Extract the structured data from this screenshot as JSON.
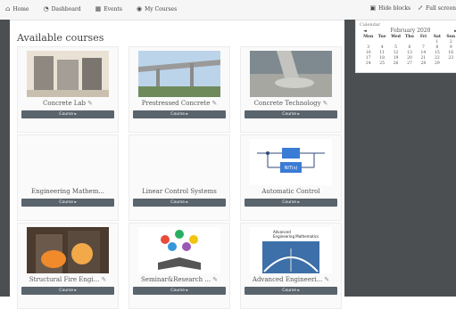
{
  "nav": {
    "home": {
      "label": "Home",
      "icon": "home-icon"
    },
    "dashboard": {
      "label": "Dashboard",
      "icon": "dashboard-icon"
    },
    "events": {
      "label": "Events",
      "icon": "calendar-icon"
    },
    "my_courses": {
      "label": "My Courses",
      "icon": "courses-icon"
    }
  },
  "topright": {
    "hide_blocks": "Hide blocks",
    "full_screen": "Full screen"
  },
  "page": {
    "title": "Available courses"
  },
  "courses": [
    {
      "name": "Concrete Lab",
      "button": "Course ▸"
    },
    {
      "name": "Prestressed Concrete",
      "button": "Course ▸"
    },
    {
      "name": "Concrete Technology",
      "button": "Course ▸"
    },
    {
      "name": "Engineering Mathem...",
      "button": "Course ▸"
    },
    {
      "name": "Linear Control Systems",
      "button": "Course ▸"
    },
    {
      "name": "Automatic Control",
      "button": "Course ▸"
    },
    {
      "name": "Structural Fire Engi...",
      "button": "Course ▸"
    },
    {
      "name": "Seminar&Research ...",
      "button": "Course ▸"
    },
    {
      "name": "Advanced Engineeri...",
      "button": "Course ▸"
    }
  ],
  "thumb_text": {
    "nit_label": "NIT(s)",
    "book_title_line1": "Advanced",
    "book_title_line2": "Engineering Mathematics"
  },
  "calendar": {
    "header": "Calendar",
    "month": "February 2020",
    "prev": "◄",
    "next": "►",
    "dow": [
      "Mon",
      "Tue",
      "Wed",
      "Thu",
      "Fri",
      "Sat",
      "Sun"
    ],
    "days": [
      "",
      "",
      "",
      "",
      "",
      "1",
      "2",
      "3",
      "4",
      "5",
      "6",
      "7",
      "8",
      "9",
      "10",
      "11",
      "12",
      "13",
      "14",
      "15",
      "16",
      "17",
      "18",
      "19",
      "20",
      "21",
      "22",
      "23",
      "24",
      "25",
      "26",
      "27",
      "28",
      "29"
    ]
  },
  "colors": {
    "sidebar_dark": "#4b4f52",
    "button": "#5a646c"
  }
}
